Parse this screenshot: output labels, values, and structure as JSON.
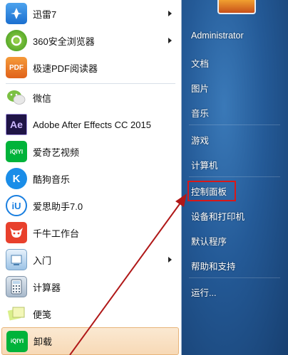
{
  "programs": [
    {
      "label": "迅雷7",
      "icon": "xunlei-icon",
      "has_arrow": true
    },
    {
      "label": "360安全浏览器",
      "icon": "browser-360-icon",
      "has_arrow": true
    },
    {
      "label": "极速PDF阅读器",
      "icon": "pdf-reader-icon",
      "icon_text": "PDF",
      "has_arrow": false
    },
    {
      "label": "微信",
      "icon": "wechat-icon",
      "has_arrow": false
    },
    {
      "label": "Adobe After Effects CC 2015",
      "icon": "after-effects-icon",
      "icon_text": "Ae",
      "has_arrow": false
    },
    {
      "label": "爱奇艺视频",
      "icon": "iqiyi-icon",
      "icon_text": "iQIYI",
      "has_arrow": false
    },
    {
      "label": "酷狗音乐",
      "icon": "kugou-icon",
      "icon_text": "K",
      "has_arrow": false
    },
    {
      "label": "爱思助手7.0",
      "icon": "i4-assistant-icon",
      "icon_text": "iU",
      "has_arrow": false
    },
    {
      "label": "千牛工作台",
      "icon": "qianniu-icon",
      "has_arrow": false
    },
    {
      "label": "入门",
      "icon": "getting-started-icon",
      "has_arrow": true
    },
    {
      "label": "计算器",
      "icon": "calculator-icon",
      "has_arrow": false
    },
    {
      "label": "便笺",
      "icon": "sticky-notes-icon",
      "has_arrow": false
    },
    {
      "label": "卸载",
      "icon": "uninstall-icon",
      "icon_text": "iQIYI",
      "has_arrow": false
    }
  ],
  "right_menu": {
    "user": "Administrator",
    "items": [
      "文档",
      "图片",
      "音乐",
      "游戏",
      "计算机",
      "控制面板",
      "设备和打印机",
      "默认程序",
      "帮助和支持",
      "运行..."
    ],
    "highlighted": "控制面板"
  },
  "colors": {
    "highlight_box": "#d81818",
    "annotation_arrow": "#b01818",
    "right_pane": "#245a97"
  }
}
